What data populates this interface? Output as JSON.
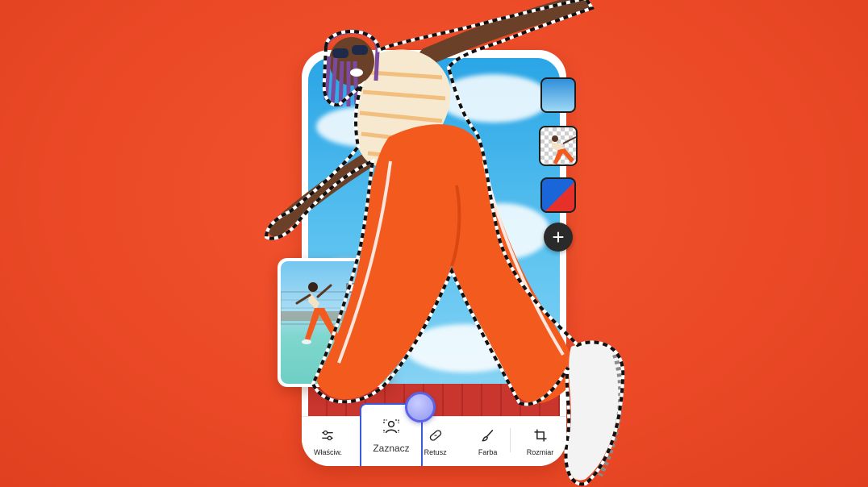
{
  "toolbar": {
    "tools": [
      {
        "label": "Właściw.",
        "icon": "sliders-icon"
      },
      {
        "label": "Zaznacz",
        "icon": "person-select-icon"
      },
      {
        "label": "Retusz",
        "icon": "bandage-icon"
      },
      {
        "label": "Farba",
        "icon": "brush-icon"
      },
      {
        "label": "Rozmiar",
        "icon": "crop-icon"
      }
    ],
    "active": "Zaznacz"
  },
  "layers": [
    {
      "icon": "sky-layer-icon"
    },
    {
      "icon": "cutout-layer-icon"
    },
    {
      "icon": "color-layer-icon"
    }
  ],
  "add_layer_label": "+",
  "colors": {
    "background": "#ec4a27",
    "accent": "#3b5bdb",
    "indicator": "#8e95f0",
    "pants": "#f25a1e"
  }
}
